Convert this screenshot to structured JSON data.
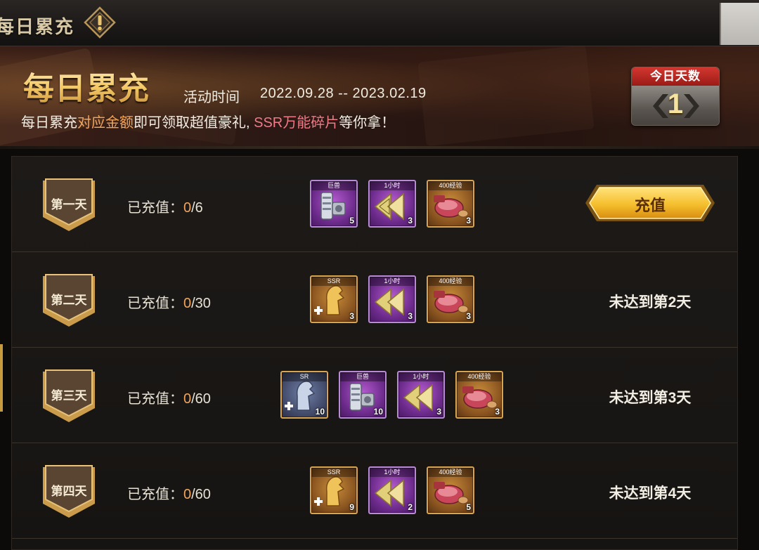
{
  "topbar": {
    "title": "每日累充",
    "info_icon": "exclamation-diamond-icon"
  },
  "banner": {
    "title": "每日累充",
    "time_label": "活动时间",
    "time_value": "2022.09.28 -- 2023.02.19",
    "desc_part1": "每日累充",
    "desc_part2": "对应金额",
    "desc_part3": "即可领取超值豪礼, ",
    "desc_part4": "SSR万能碎片",
    "desc_part5": "等你拿！"
  },
  "day_counter": {
    "label": "今日天数",
    "value": "1"
  },
  "rows": [
    {
      "day": "第一天",
      "progress_prefix": "已充值：",
      "progress_current": "0",
      "progress_target": "/6",
      "rewards": [
        {
          "tag": "巨兽",
          "count": "5",
          "kind": "purple",
          "icon": "canister-icon"
        },
        {
          "tag": "1小时",
          "count": "3",
          "kind": "purple",
          "icon": "speedup-arrows-icon"
        },
        {
          "tag": "400经验",
          "count": "3",
          "kind": "gold",
          "icon": "meat-icon"
        }
      ],
      "action": "button",
      "action_label": "充值"
    },
    {
      "day": "第二天",
      "progress_prefix": "已充值：",
      "progress_current": "0",
      "progress_target": "/30",
      "rewards": [
        {
          "tag": "SSR",
          "count": "3",
          "kind": "gold",
          "icon": "hero-shard-icon"
        },
        {
          "tag": "1小时",
          "count": "3",
          "kind": "purple",
          "icon": "speedup-arrows-icon"
        },
        {
          "tag": "400经验",
          "count": "3",
          "kind": "gold",
          "icon": "meat-icon"
        }
      ],
      "action": "text",
      "action_label": "未达到第2天"
    },
    {
      "day": "第三天",
      "progress_prefix": "已充值：",
      "progress_current": "0",
      "progress_target": "/60",
      "rewards": [
        {
          "tag": "SR",
          "count": "10",
          "kind": "blue",
          "icon": "hero-shard-icon"
        },
        {
          "tag": "巨兽",
          "count": "10",
          "kind": "purple",
          "icon": "canister-icon"
        },
        {
          "tag": "1小时",
          "count": "3",
          "kind": "purple",
          "icon": "speedup-arrows-icon"
        },
        {
          "tag": "400经验",
          "count": "3",
          "kind": "gold",
          "icon": "meat-icon"
        }
      ],
      "action": "text",
      "action_label": "未达到第3天"
    },
    {
      "day": "第四天",
      "progress_prefix": "已充值：",
      "progress_current": "0",
      "progress_target": "/60",
      "rewards": [
        {
          "tag": "SSR",
          "count": "9",
          "kind": "gold",
          "icon": "hero-shard-icon"
        },
        {
          "tag": "1小时",
          "count": "2",
          "kind": "purple",
          "icon": "speedup-arrows-icon"
        },
        {
          "tag": "400经验",
          "count": "5",
          "kind": "gold",
          "icon": "meat-icon"
        }
      ],
      "action": "text",
      "action_label": "未达到第4天"
    }
  ],
  "colors": {
    "accent_orange": "#f2a55a",
    "accent_pink": "#f07a86",
    "button_gold": "#f5c342",
    "counter_red": "#c8302a"
  }
}
